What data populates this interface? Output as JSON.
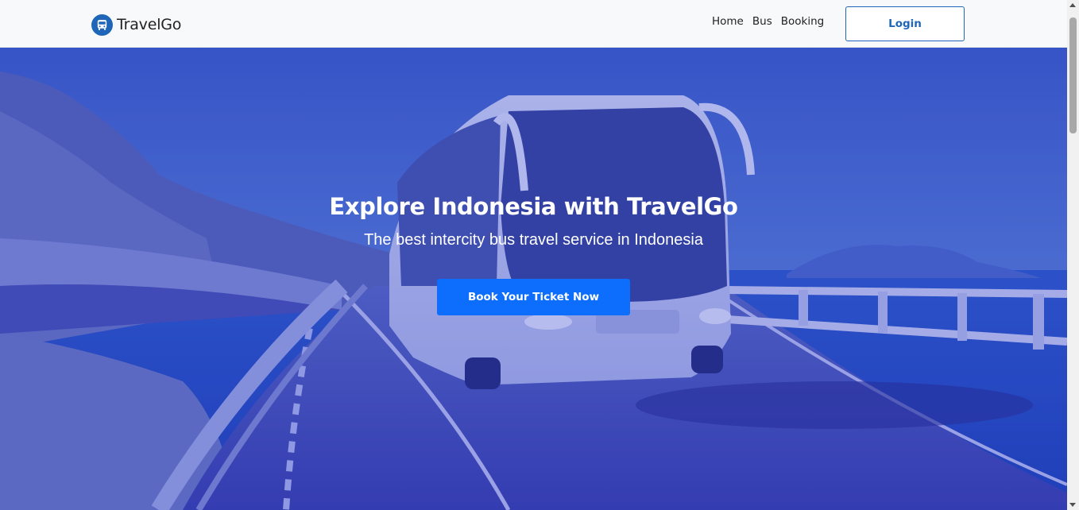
{
  "navbar": {
    "brand": {
      "name": "TravelGo",
      "icon": "bus-icon",
      "icon_color": "#1f66b8"
    },
    "links": [
      {
        "label": "Home"
      },
      {
        "label": "Bus"
      },
      {
        "label": "Booking"
      }
    ],
    "login_label": "Login"
  },
  "hero": {
    "title": "Explore Indonesia with TravelGo",
    "subtitle": "The best intercity bus travel service in Indonesia",
    "cta_label": "Book Your Ticket Now",
    "background": "bus-on-coastal-bridge-image",
    "overlay_color": "#2330c8"
  },
  "colors": {
    "primary": "#0d6efd",
    "brand_blue": "#1f66b8",
    "navbar_bg": "#f8f9fa"
  }
}
